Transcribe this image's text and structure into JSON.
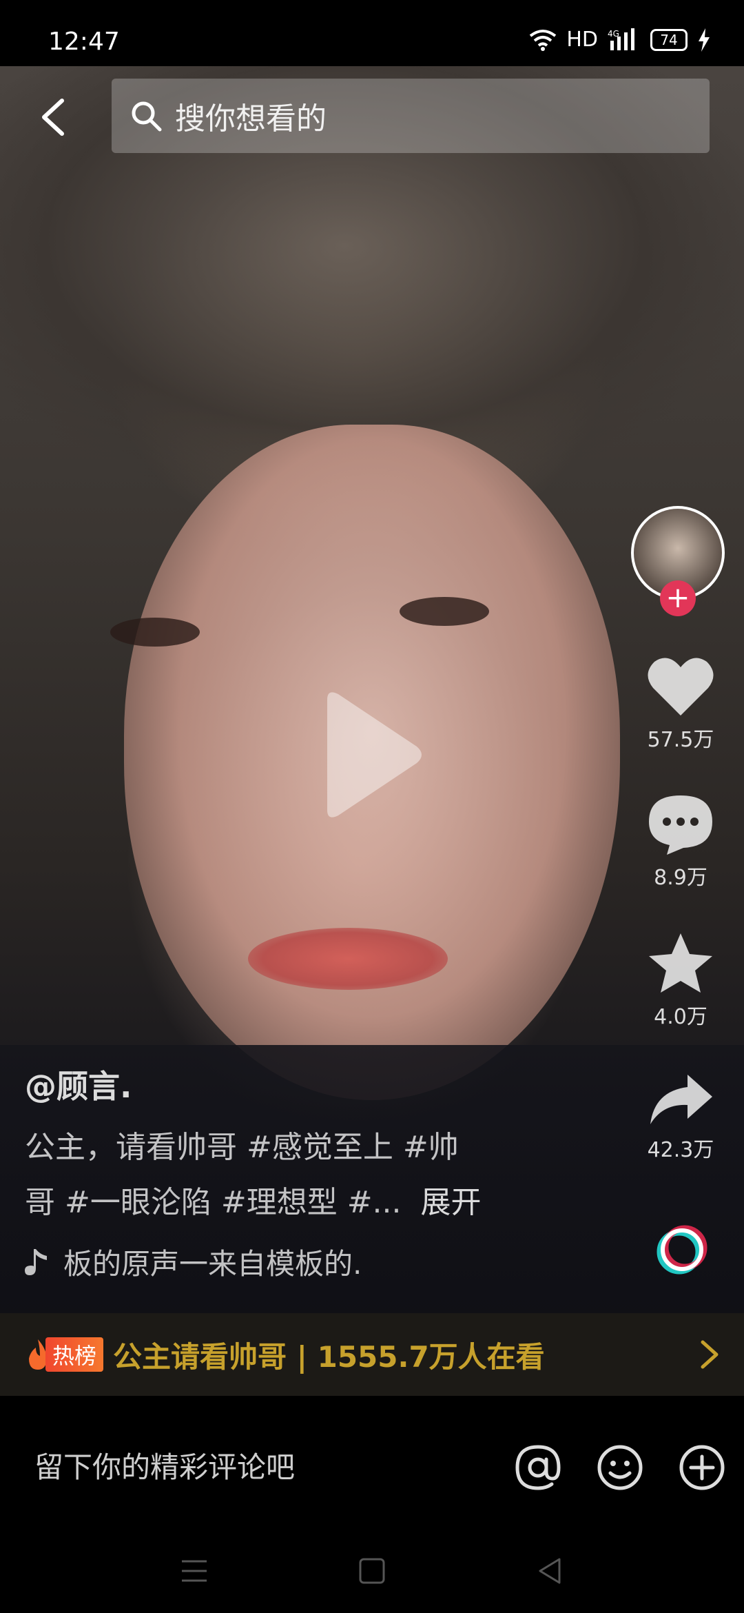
{
  "status_bar": {
    "time": "12:47",
    "hd": "HD",
    "network": "4G",
    "battery": "74",
    "icons": [
      "wifi-icon",
      "signal-icon",
      "battery-icon",
      "charging-icon"
    ]
  },
  "search": {
    "placeholder": "搜你想看的",
    "back_icon": "back-arrow-icon",
    "search_icon": "search-icon"
  },
  "video": {
    "play_icon": "play-icon"
  },
  "right_rail": {
    "like_count": "57.5万",
    "comment_count": "8.9万",
    "favorite_count": "4.0万",
    "share_count": "42.3万",
    "follow_label": "+"
  },
  "post": {
    "author": "@顾言.",
    "caption_line1": "公主，请看帅哥 #感觉至上 #帅",
    "caption_line2": "哥 #一眼沦陷 #理想型 #...",
    "expand": "展开",
    "music": "板的原声一来自模板的."
  },
  "hot_banner": {
    "badge": "热榜",
    "title": "公主请看帅哥 | 1555.7万人在看",
    "colors": {
      "title": "#c7a12c",
      "badge": "#f0462e"
    }
  },
  "comment_bar": {
    "placeholder": "留下你的精彩评论吧",
    "icons": [
      "at-icon",
      "emoji-icon",
      "add-icon"
    ]
  },
  "nav_bar": {
    "icons": [
      "menu-icon",
      "home-square-icon",
      "back-triangle-icon"
    ]
  },
  "colors": {
    "accent": "#e23658",
    "background": "#000000"
  }
}
